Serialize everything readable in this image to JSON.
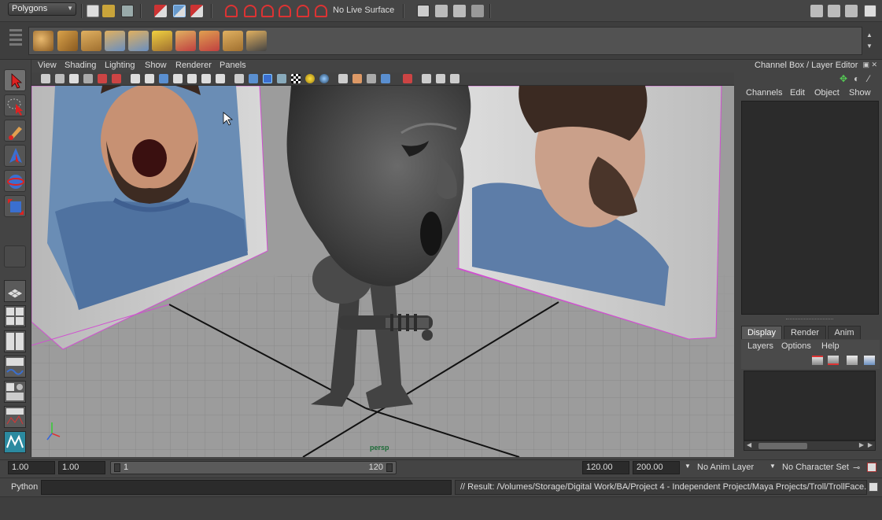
{
  "status_line": {
    "menu_set": "Polygons",
    "live_surface": "No Live Surface"
  },
  "viewport": {
    "menus": [
      "View",
      "Shading",
      "Lighting",
      "Show",
      "Renderer",
      "Panels"
    ],
    "camera_label": "persp"
  },
  "channel_box": {
    "title": "Channel Box / Layer Editor",
    "menus": [
      "Channels",
      "Edit",
      "Object",
      "Show"
    ]
  },
  "layer_editor": {
    "tabs": [
      "Display",
      "Render",
      "Anim"
    ],
    "active_tab": "Display",
    "menus": [
      "Layers",
      "Options",
      "Help"
    ]
  },
  "range_slider": {
    "start_time": "1.00",
    "playback_start": "1.00",
    "slider_low": "1",
    "slider_high": "120",
    "playback_end": "120.00",
    "end_time": "200.00",
    "anim_layer": "No Anim Layer",
    "character_set": "No Character Set"
  },
  "command_line": {
    "language": "Python",
    "result": "// Result: /Volumes/Storage/Digital Work/BA/Project 4 - Independent Project/Maya Projects/Troll/TrollFace.m"
  },
  "colors": {
    "ui_bg": "#444444",
    "field_bg": "#2b2b2b",
    "grid": "#8e8e8e",
    "axis_line": "#111111",
    "selection_magenta": "#d050d0",
    "camera_label": "#1c6b37"
  }
}
